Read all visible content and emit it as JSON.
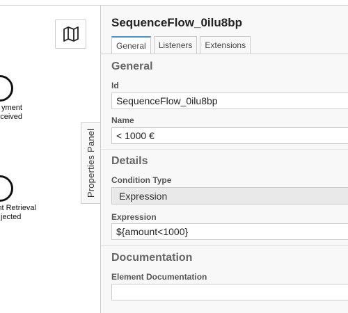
{
  "canvas": {
    "events": [
      {
        "label_line1": "yment",
        "label_line2": "ceived"
      },
      {
        "label_line1": "nt Retrieval",
        "label_line2": "jected"
      }
    ],
    "minimap_icon": "map-icon"
  },
  "toggle": {
    "label": "Properties Panel"
  },
  "panel": {
    "title": "SequenceFlow_0ilu8bp",
    "tabs": [
      {
        "label": "General",
        "active": true
      },
      {
        "label": "Listeners",
        "active": false
      },
      {
        "label": "Extensions",
        "active": false
      }
    ],
    "general": {
      "heading": "General",
      "id_label": "Id",
      "id_value": "SequenceFlow_0ilu8bp",
      "name_label": "Name",
      "name_value": "< 1000 €"
    },
    "details": {
      "heading": "Details",
      "condition_type_label": "Condition Type",
      "condition_type_value": "Expression",
      "expression_label": "Expression",
      "expression_value": "${amount<1000}"
    },
    "documentation": {
      "heading": "Documentation",
      "element_doc_label": "Element Documentation",
      "element_doc_value": ""
    }
  },
  "colors": {
    "active_tab_accent": "#4a90d9",
    "panel_bg": "#f8f8f8",
    "border": "#cccccc"
  }
}
